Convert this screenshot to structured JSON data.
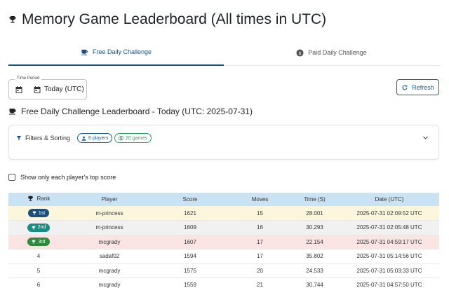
{
  "header": {
    "title": "Memory Game Leaderboard (All times in UTC)",
    "icon": "trophy-icon"
  },
  "tabs": [
    {
      "label": "Free Daily Challenge",
      "icon": "coffee-icon",
      "active": true
    },
    {
      "label": "Paid Daily Challenge",
      "icon": "dollar-icon",
      "active": false
    }
  ],
  "time_period": {
    "legend": "Time Period",
    "value": "Today (UTC)"
  },
  "refresh": {
    "label": "Refresh"
  },
  "section": {
    "title": "Free Daily Challenge Leaderboard - Today (UTC: 2025-07-31)"
  },
  "filters": {
    "label": "Filters & Sorting",
    "players_chip": "6 players",
    "games_chip": "20 games"
  },
  "top_score_toggle": {
    "label": "Show only each player's top score",
    "checked": false
  },
  "table": {
    "columns": [
      "Rank",
      "Player",
      "Score",
      "Moves",
      "Time (S)",
      "Date (UTC)"
    ],
    "rows": [
      {
        "rank": "1st",
        "player": "m-princess",
        "score": "1621",
        "moves": "15",
        "time": "28.001",
        "date": "2025-07-31 02:09:52 UTC"
      },
      {
        "rank": "2nd",
        "player": "m-princess",
        "score": "1609",
        "moves": "16",
        "time": "30.293",
        "date": "2025-07-31 02:05:48 UTC"
      },
      {
        "rank": "3rd",
        "player": "mcgrady",
        "score": "1607",
        "moves": "17",
        "time": "22.154",
        "date": "2025-07-31 04:59:17 UTC"
      },
      {
        "rank": "4",
        "player": "sadaf02",
        "score": "1594",
        "moves": "17",
        "time": "35.802",
        "date": "2025-07-31 05:14:56 UTC"
      },
      {
        "rank": "5",
        "player": "mcgrady",
        "score": "1575",
        "moves": "20",
        "time": "24.533",
        "date": "2025-07-31 05:03:33 UTC"
      },
      {
        "rank": "6",
        "player": "mcgrady",
        "score": "1559",
        "moves": "21",
        "time": "30.744",
        "date": "2025-07-31 04:57:50 UTC"
      }
    ]
  },
  "colors": {
    "accent": "#1b4f7a",
    "header_row": "#c9e2f4",
    "gold_row": "#fcf6dc",
    "silver_row": "#f1f1f1",
    "bronze_row": "#fbe4e4"
  }
}
